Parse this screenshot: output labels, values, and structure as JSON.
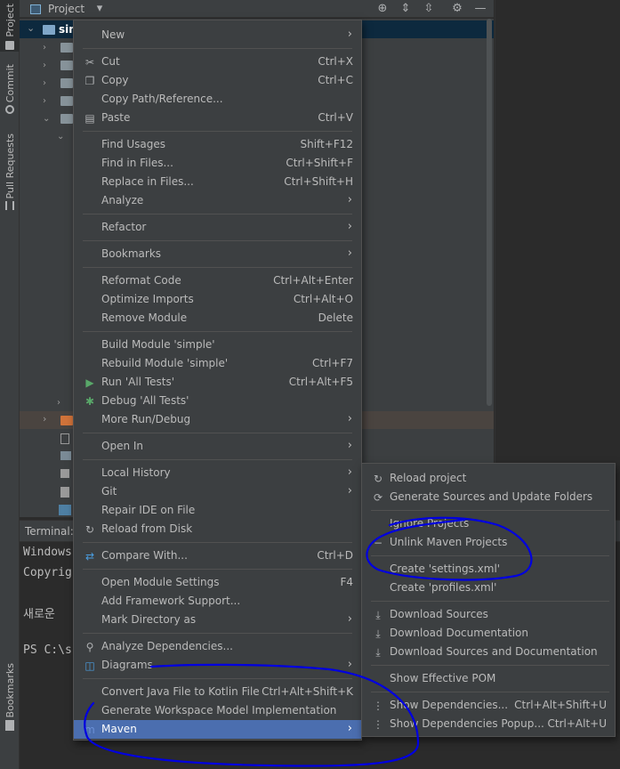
{
  "left_strip": {
    "tabs": [
      "Project",
      "Commit",
      "Pull Requests",
      "Bookmarks"
    ]
  },
  "project_panel": {
    "title": "Project",
    "root_label": "sim"
  },
  "terminal": {
    "label": "Terminal:",
    "lines": [
      "Windows",
      "Copyrig",
      "새로운",
      "PS C:\\s"
    ]
  },
  "context_menu": {
    "items": [
      {
        "label": "New",
        "shortcut": "",
        "submenu": true,
        "icon": ""
      },
      {
        "label": "Cut",
        "shortcut": "Ctrl+X",
        "submenu": false,
        "icon": "scissors-icon"
      },
      {
        "label": "Copy",
        "shortcut": "Ctrl+C",
        "submenu": false,
        "icon": "copy-icon"
      },
      {
        "label": "Copy Path/Reference...",
        "shortcut": "",
        "submenu": false,
        "icon": ""
      },
      {
        "label": "Paste",
        "shortcut": "Ctrl+V",
        "submenu": false,
        "icon": "paste-icon"
      },
      {
        "label": "Find Usages",
        "shortcut": "Shift+F12",
        "submenu": false,
        "icon": ""
      },
      {
        "label": "Find in Files...",
        "shortcut": "Ctrl+Shift+F",
        "submenu": false,
        "icon": ""
      },
      {
        "label": "Replace in Files...",
        "shortcut": "Ctrl+Shift+H",
        "submenu": false,
        "icon": ""
      },
      {
        "label": "Analyze",
        "shortcut": "",
        "submenu": true,
        "icon": ""
      },
      {
        "label": "Refactor",
        "shortcut": "",
        "submenu": true,
        "icon": ""
      },
      {
        "label": "Bookmarks",
        "shortcut": "",
        "submenu": true,
        "icon": ""
      },
      {
        "label": "Reformat Code",
        "shortcut": "Ctrl+Alt+Enter",
        "submenu": false,
        "icon": ""
      },
      {
        "label": "Optimize Imports",
        "shortcut": "Ctrl+Alt+O",
        "submenu": false,
        "icon": ""
      },
      {
        "label": "Remove Module",
        "shortcut": "Delete",
        "submenu": false,
        "icon": ""
      },
      {
        "label": "Build Module 'simple'",
        "shortcut": "",
        "submenu": false,
        "icon": ""
      },
      {
        "label": "Rebuild Module 'simple'",
        "shortcut": "Ctrl+F7",
        "submenu": false,
        "icon": ""
      },
      {
        "label": "Run 'All Tests'",
        "shortcut": "Ctrl+Alt+F5",
        "submenu": false,
        "icon": "run-icon"
      },
      {
        "label": "Debug 'All Tests'",
        "shortcut": "",
        "submenu": false,
        "icon": "debug-icon"
      },
      {
        "label": "More Run/Debug",
        "shortcut": "",
        "submenu": true,
        "icon": ""
      },
      {
        "label": "Open In",
        "shortcut": "",
        "submenu": true,
        "icon": ""
      },
      {
        "label": "Local History",
        "shortcut": "",
        "submenu": true,
        "icon": ""
      },
      {
        "label": "Git",
        "shortcut": "",
        "submenu": true,
        "icon": ""
      },
      {
        "label": "Repair IDE on File",
        "shortcut": "",
        "submenu": false,
        "icon": ""
      },
      {
        "label": "Reload from Disk",
        "shortcut": "",
        "submenu": false,
        "icon": "reload-icon"
      },
      {
        "label": "Compare With...",
        "shortcut": "Ctrl+D",
        "submenu": false,
        "icon": "compare-icon"
      },
      {
        "label": "Open Module Settings",
        "shortcut": "F4",
        "submenu": false,
        "icon": ""
      },
      {
        "label": "Add Framework Support...",
        "shortcut": "",
        "submenu": false,
        "icon": ""
      },
      {
        "label": "Mark Directory as",
        "shortcut": "",
        "submenu": true,
        "icon": ""
      },
      {
        "label": "Analyze Dependencies...",
        "shortcut": "",
        "submenu": false,
        "icon": "analyze-dependencies-icon"
      },
      {
        "label": "Diagrams",
        "shortcut": "",
        "submenu": true,
        "icon": "diagram-icon"
      },
      {
        "label": "Convert Java File to Kotlin File",
        "shortcut": "Ctrl+Alt+Shift+K",
        "submenu": false,
        "icon": ""
      },
      {
        "label": "Generate Workspace Model Implementation",
        "shortcut": "",
        "submenu": false,
        "icon": ""
      },
      {
        "label": "Maven",
        "shortcut": "",
        "submenu": true,
        "icon": "maven-icon",
        "selected": true
      }
    ]
  },
  "maven_submenu": {
    "items": [
      {
        "label": "Reload project",
        "shortcut": "",
        "icon": "reload-icon"
      },
      {
        "label": "Generate Sources and Update Folders",
        "shortcut": "",
        "icon": "generate-sources-icon"
      },
      {
        "label": "Ignore Projects",
        "shortcut": "",
        "icon": ""
      },
      {
        "label": "Unlink Maven Projects",
        "shortcut": "",
        "icon": "minus-icon"
      },
      {
        "label": "Create 'settings.xml'",
        "shortcut": "",
        "icon": ""
      },
      {
        "label": "Create 'profiles.xml'",
        "shortcut": "",
        "icon": ""
      },
      {
        "label": "Download Sources",
        "shortcut": "",
        "icon": "download-icon"
      },
      {
        "label": "Download Documentation",
        "shortcut": "",
        "icon": "download-icon"
      },
      {
        "label": "Download Sources and Documentation",
        "shortcut": "",
        "icon": "download-icon"
      },
      {
        "label": "Show Effective POM",
        "shortcut": "",
        "icon": ""
      },
      {
        "label": "Show Dependencies...",
        "shortcut": "Ctrl+Alt+Shift+U",
        "icon": "dependencies-icon"
      },
      {
        "label": "Show Dependencies Popup...",
        "shortcut": "Ctrl+Alt+U",
        "icon": "dependencies-icon"
      }
    ]
  },
  "colors": {
    "background": "#2b2b2b",
    "panel": "#3c3f41",
    "selection": "#4b6eaf",
    "annotation": "#0000e0"
  }
}
